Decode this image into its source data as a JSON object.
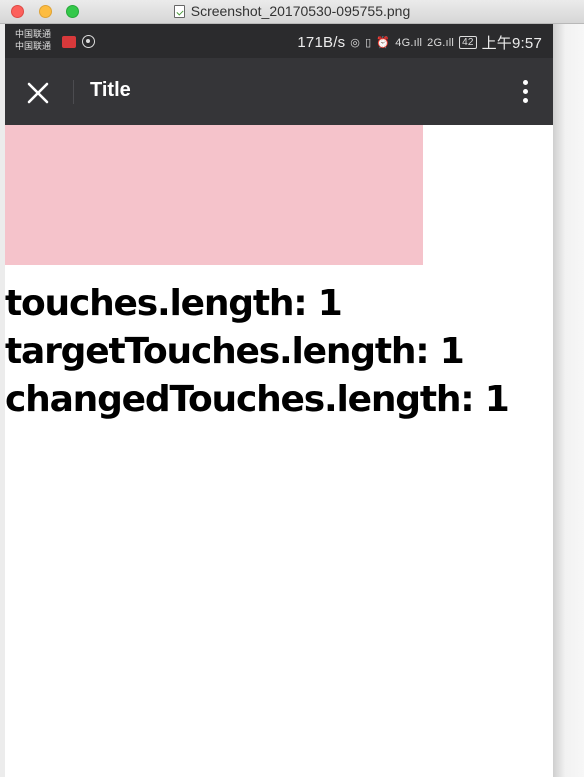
{
  "window": {
    "file_title": "Screenshot_20170530-095755.png",
    "buttons": [
      "close",
      "minimize",
      "zoom"
    ]
  },
  "status_bar": {
    "carrier_1": "中国联通",
    "carrier_2": "中国联通",
    "net_speed": "171B/s",
    "signal_1_label": "4G",
    "signal_2_label": "2G",
    "battery": "42",
    "time": "上午9:57"
  },
  "app_bar": {
    "title": "Title",
    "close_icon": "close-icon",
    "more_icon": "more-vertical-icon",
    "background_color": "#353538"
  },
  "touch_area": {
    "color": "#f5c3cb"
  },
  "readouts": {
    "touches": "touches.length: 1",
    "target_touches": "targetTouches.length: 1",
    "changed_touches": "changedTouches.length: 1"
  }
}
